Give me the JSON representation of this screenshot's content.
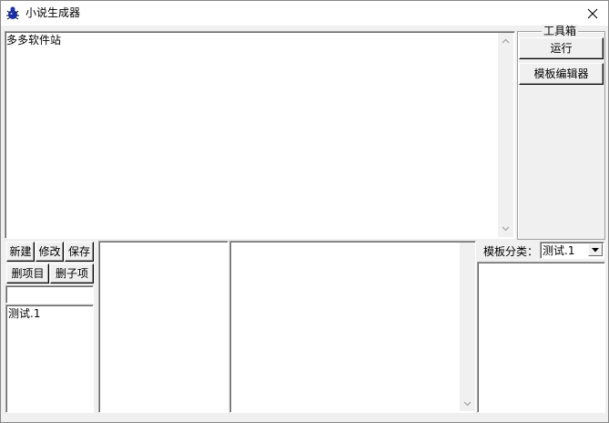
{
  "window": {
    "title": "小说生成器",
    "icon": "bug-icon",
    "close_icon": "close-icon"
  },
  "editor": {
    "content": "多多软件站"
  },
  "toolbox": {
    "title": "工具箱",
    "run_label": "运行",
    "template_editor_label": "模板编辑器"
  },
  "project_panel": {
    "buttons": {
      "new": "新建",
      "edit": "修改",
      "save": "保存",
      "delete_item": "删项目",
      "delete_child": "删子项"
    },
    "input_value": "",
    "items": [
      "测试.1"
    ]
  },
  "template_panel": {
    "category_label": "模板分类：",
    "category_value": "测试.1"
  },
  "colors": {
    "window_bg": "#f0f0f0",
    "field_bg": "#ffffff",
    "shadow": "#696969"
  }
}
